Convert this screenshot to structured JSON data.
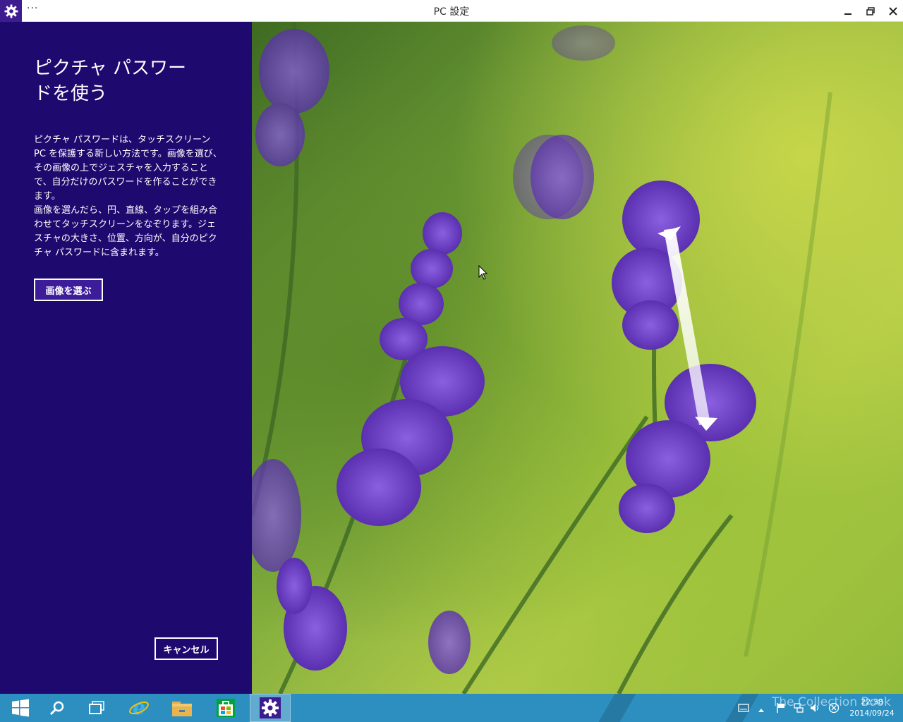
{
  "window": {
    "title": "PC 設定",
    "menu_label": "···"
  },
  "panel": {
    "heading": "ピクチャ パスワードを使う",
    "paragraph1": "ピクチャ パスワードは、タッチスクリーン PC を保護する新しい方法です。画像を選び、その画像の上でジェスチャを入力することで、自分だけのパスワードを作ることができます。",
    "paragraph2": "画像を選んだら、円、直線、タップを組み合わせてタッチスクリーンをなぞります。ジェスチャの大きさ、位置、方向が、自分のピクチャ パスワードに含まれます。",
    "choose_button": "画像を選ぶ",
    "cancel_button": "キャンセル"
  },
  "taskbar": {
    "clock_time": "22:38",
    "clock_date": "2014/09/24",
    "watermark": "The Collection Book"
  },
  "colors": {
    "panel_bg": "#1e0a6e",
    "taskbar_bg": "#2c8fc0",
    "accent": "#3d1c8f"
  }
}
